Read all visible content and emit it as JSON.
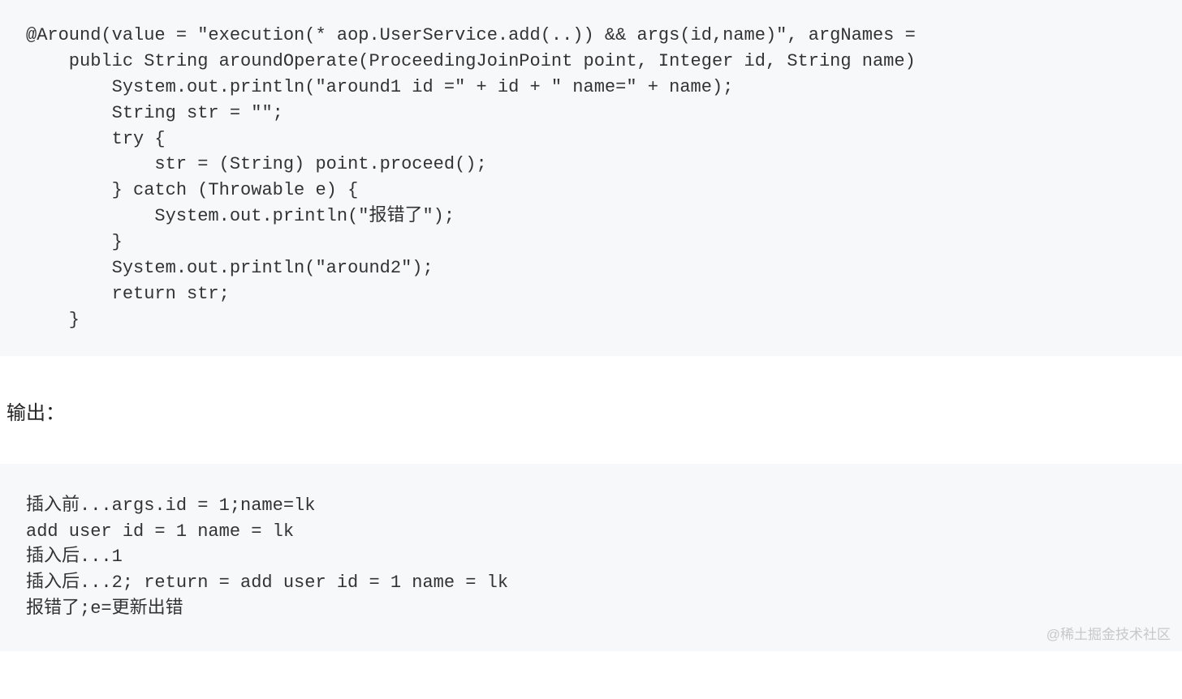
{
  "codeBlock1": {
    "lines": [
      "@Around(value = \"execution(* aop.UserService.add(..)) && args(id,name)\", argNames =",
      "    public String aroundOperate(ProceedingJoinPoint point, Integer id, String name)",
      "        System.out.println(\"around1 id =\" + id + \" name=\" + name);",
      "        String str = \"\";",
      "        try {",
      "            str = (String) point.proceed();",
      "        } catch (Throwable e) {",
      "            System.out.println(\"报错了\");",
      "        }",
      "        System.out.println(\"around2\");",
      "        return str;",
      "    }",
      ""
    ]
  },
  "outputLabel": "输出：",
  "outputBlock": {
    "lines": [
      "插入前...args.id = 1;name=lk",
      "add user id = 1 name = lk",
      "插入后...1",
      "插入后...2; return = add user id = 1 name = lk",
      "报错了;e=更新出错"
    ]
  },
  "watermark": "@稀土掘金技术社区"
}
